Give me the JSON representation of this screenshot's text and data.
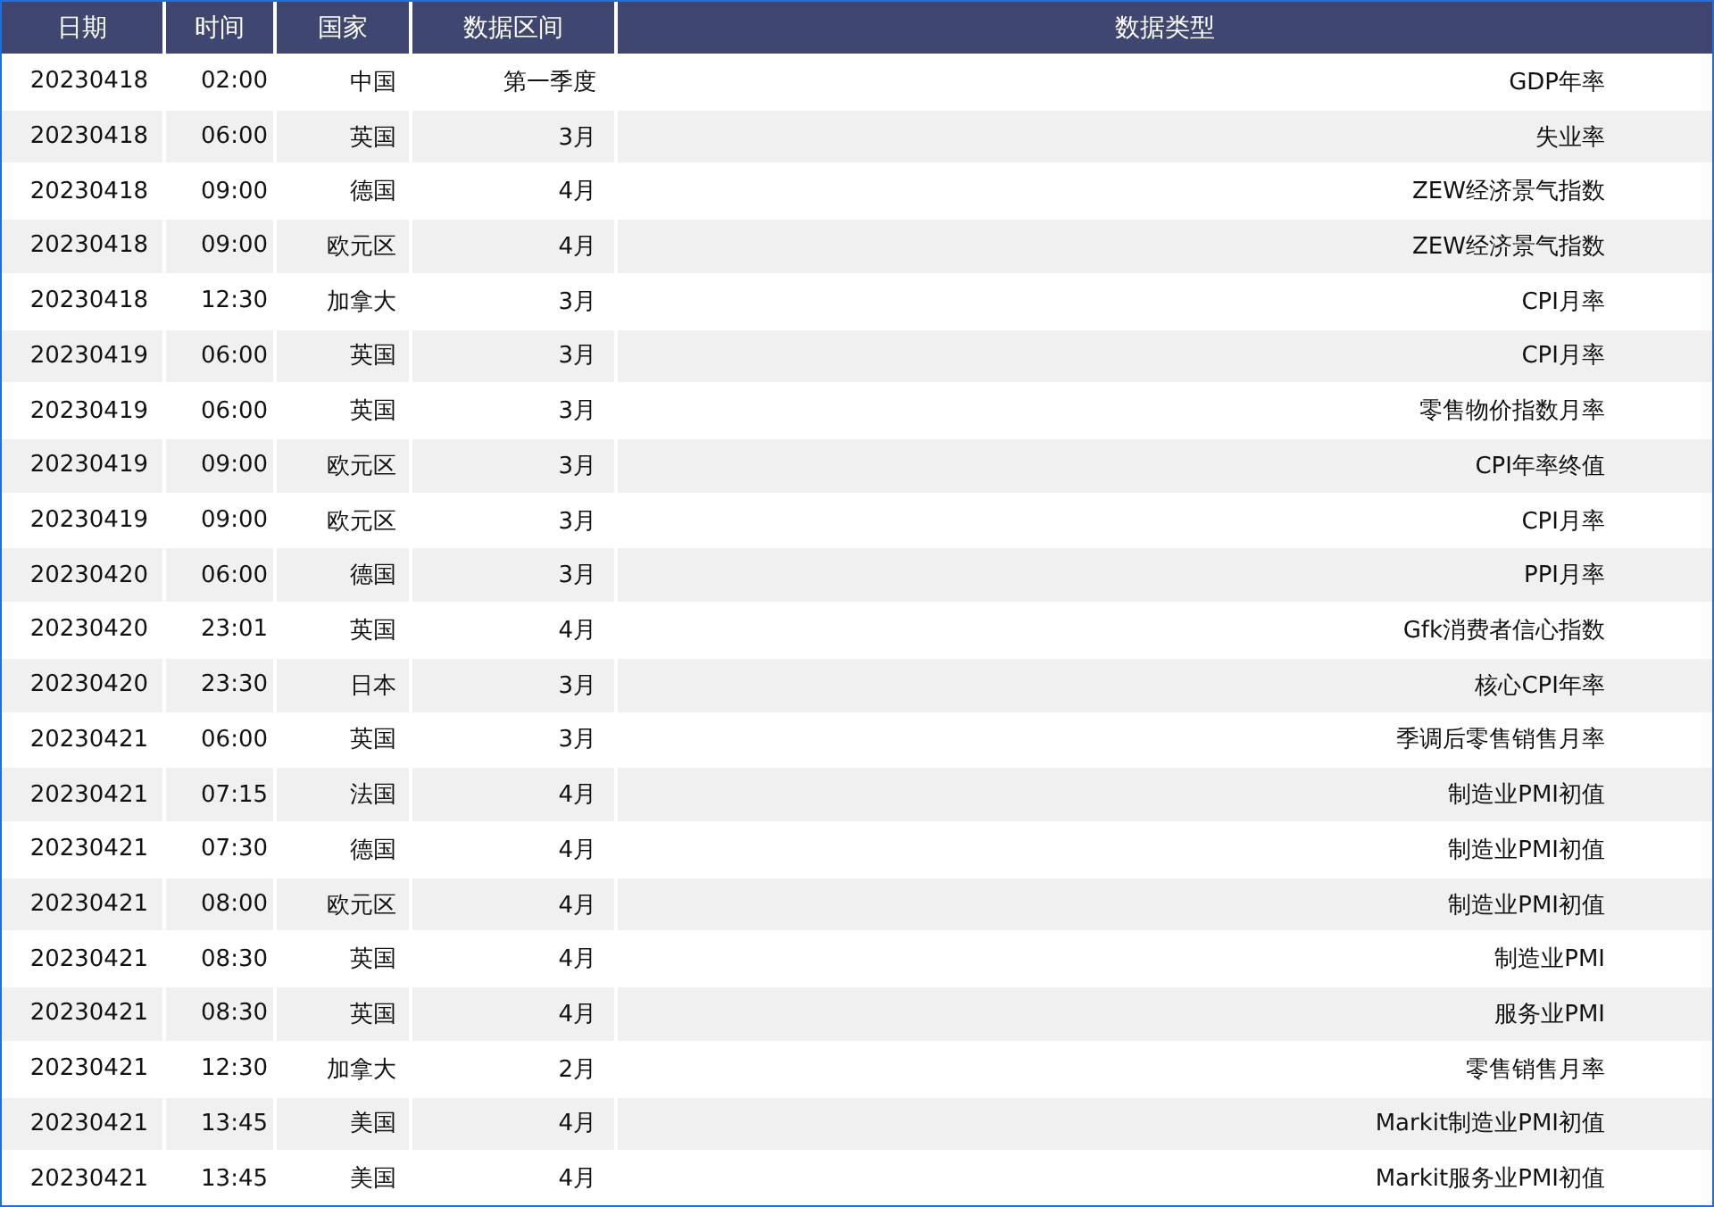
{
  "table": {
    "columns": [
      "日期",
      "时间",
      "国家",
      "数据区间",
      "数据类型"
    ],
    "rows": [
      [
        "20230418",
        "02:00",
        "中国",
        "第一季度",
        "GDP年率"
      ],
      [
        "20230418",
        "06:00",
        "英国",
        "3月",
        "失业率"
      ],
      [
        "20230418",
        "09:00",
        "德国",
        "4月",
        "ZEW经济景气指数"
      ],
      [
        "20230418",
        "09:00",
        "欧元区",
        "4月",
        "ZEW经济景气指数"
      ],
      [
        "20230418",
        "12:30",
        "加拿大",
        "3月",
        "CPI月率"
      ],
      [
        "20230419",
        "06:00",
        "英国",
        "3月",
        "CPI月率"
      ],
      [
        "20230419",
        "06:00",
        "英国",
        "3月",
        "零售物价指数月率"
      ],
      [
        "20230419",
        "09:00",
        "欧元区",
        "3月",
        "CPI年率终值"
      ],
      [
        "20230419",
        "09:00",
        "欧元区",
        "3月",
        "CPI月率"
      ],
      [
        "20230420",
        "06:00",
        "德国",
        "3月",
        "PPI月率"
      ],
      [
        "20230420",
        "23:01",
        "英国",
        "4月",
        "Gfk消费者信心指数"
      ],
      [
        "20230420",
        "23:30",
        "日本",
        "3月",
        "核心CPI年率"
      ],
      [
        "20230421",
        "06:00",
        "英国",
        "3月",
        "季调后零售销售月率"
      ],
      [
        "20230421",
        "07:15",
        "法国",
        "4月",
        "制造业PMI初值"
      ],
      [
        "20230421",
        "07:30",
        "德国",
        "4月",
        "制造业PMI初值"
      ],
      [
        "20230421",
        "08:00",
        "欧元区",
        "4月",
        "制造业PMI初值"
      ],
      [
        "20230421",
        "08:30",
        "英国",
        "4月",
        "制造业PMI"
      ],
      [
        "20230421",
        "08:30",
        "英国",
        "4月",
        "服务业PMI"
      ],
      [
        "20230421",
        "12:30",
        "加拿大",
        "2月",
        "零售销售月率"
      ],
      [
        "20230421",
        "13:45",
        "美国",
        "4月",
        "Markit制造业PMI初值"
      ],
      [
        "20230421",
        "13:45",
        "美国",
        "4月",
        "Markit服务业PMI初值"
      ]
    ]
  }
}
